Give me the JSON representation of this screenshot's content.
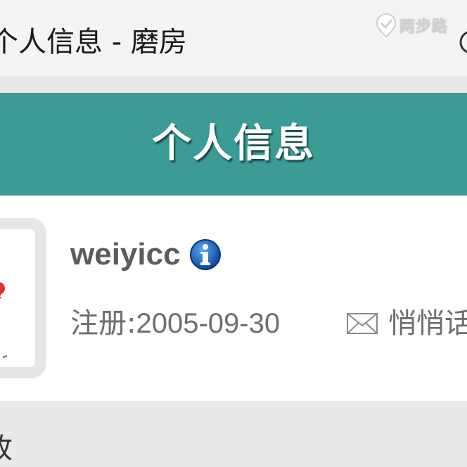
{
  "browser": {
    "title": "个人信息 - 磨房",
    "watermark": "两步路"
  },
  "header": {
    "title": "个人信息"
  },
  "profile": {
    "username": "weiyicc",
    "register_label": "注册:",
    "register_date": "2005-09-30",
    "pm_label": "悄悄话"
  },
  "bottom": {
    "text": "收"
  },
  "colors": {
    "header_bg": "#3b9c96",
    "page_bg": "#e9e9e9",
    "card_bg": "#ffffff",
    "info_icon": "#1565c0"
  },
  "icons": {
    "watermark": "map-pin-icon",
    "title_edge": "circle-icon",
    "info": "info-icon",
    "mail": "mail-icon"
  }
}
